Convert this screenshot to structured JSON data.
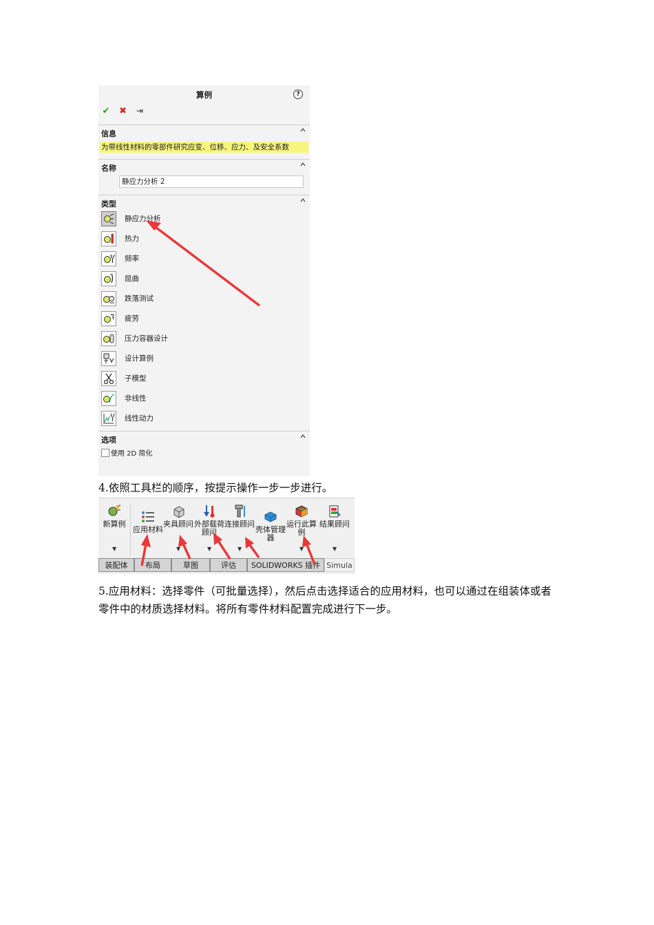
{
  "panel": {
    "title": "算例",
    "help_icon": "question-icon",
    "actions": [
      {
        "name": "ok",
        "icon": "check-icon",
        "glyph": "✔"
      },
      {
        "name": "cancel",
        "icon": "close-icon",
        "glyph": "✖"
      },
      {
        "name": "pin",
        "icon": "pushpin-icon",
        "glyph": "⇥"
      }
    ],
    "info": {
      "header": "信息",
      "text": "为带线性材料的零部件研究应变、位移、应力、及安全系数"
    },
    "name_section": {
      "header": "名称",
      "value": "静应力分析 2"
    },
    "type_section": {
      "header": "类型",
      "items": [
        {
          "label": "静应力分析",
          "icon": "static-study-icon",
          "selected": true
        },
        {
          "label": "热力",
          "icon": "thermal-study-icon",
          "selected": false
        },
        {
          "label": "频率",
          "icon": "frequency-study-icon",
          "selected": false
        },
        {
          "label": "屈曲",
          "icon": "buckling-study-icon",
          "selected": false
        },
        {
          "label": "跌落测试",
          "icon": "drop-test-icon",
          "selected": false
        },
        {
          "label": "疲劳",
          "icon": "fatigue-study-icon",
          "selected": false
        },
        {
          "label": "压力容器设计",
          "icon": "pressure-vessel-icon",
          "selected": false
        },
        {
          "label": "设计算例",
          "icon": "design-study-icon",
          "selected": false
        },
        {
          "label": "子模型",
          "icon": "submodel-icon",
          "selected": false
        },
        {
          "label": "非线性",
          "icon": "nonlinear-study-icon",
          "selected": false
        },
        {
          "label": "线性动力",
          "icon": "linear-dynamic-icon",
          "selected": false
        }
      ]
    },
    "options_section": {
      "header": "选项",
      "checkbox_label": "使用 2D 简化",
      "checked": false
    }
  },
  "step4": "4.依照工具栏的顺序，按提示操作一步一步进行。",
  "toolbar": {
    "buttons": [
      {
        "label": "新算例",
        "icon": "new-study-icon"
      },
      {
        "label": "应用材料",
        "icon": "apply-material-icon"
      },
      {
        "label": "夹具顾问",
        "icon": "fixtures-advisor-icon"
      },
      {
        "label": "外部载荷顾问",
        "icon": "external-loads-icon"
      },
      {
        "label": "连接顾问",
        "icon": "connections-advisor-icon"
      },
      {
        "label": "壳体管理器",
        "icon": "shell-manager-icon"
      },
      {
        "label": "运行此算例",
        "icon": "run-study-icon"
      },
      {
        "label": "结果顾问",
        "icon": "results-advisor-icon"
      }
    ],
    "tabs": [
      "装配体",
      "布局",
      "草图",
      "评估",
      "SOLIDWORKS 插件",
      "Simula"
    ]
  },
  "step5": "5.应用材料：选择零件（可批量选择），然后点击选择适合的应用材料，也可以通过在组装体或者零件中的材质选择材料。将所有零件材料配置完成进行下一步。",
  "colors": {
    "highlight": "#f7f57e",
    "arrow": "#e8393a",
    "ok": "#2a9b2a",
    "cancel": "#dd2222"
  }
}
